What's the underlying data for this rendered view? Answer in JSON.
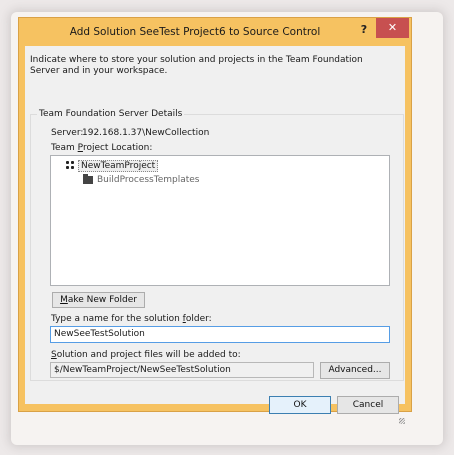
{
  "window": {
    "title": "Add Solution SeeTest Project6 to Source Control",
    "help_label": "?",
    "close_label": "✕"
  },
  "intro_text": "Indicate where to store your solution and projects in the Team Foundation Server and in your workspace.",
  "server_group": {
    "title": "Team Foundation Server Details",
    "server_label": "Server:",
    "server_value": "192.168.1.37\\NewCollection",
    "location_label_pre": "Team ",
    "location_label_key": "P",
    "location_label_post": "roject Location:"
  },
  "tree": {
    "items": [
      {
        "label": "NewTeamProject",
        "icon": "team-project-icon",
        "selected": true
      },
      {
        "label": "BuildProcessTemplates",
        "icon": "folder-icon",
        "selected": false
      }
    ]
  },
  "buttons": {
    "make_new_folder_key": "M",
    "make_new_folder_rest": "ake New Folder",
    "advanced": "Advanced...",
    "ok": "OK",
    "cancel": "Cancel"
  },
  "solution_folder": {
    "label_pre": "Type a name for the solution ",
    "label_key": "f",
    "label_post": "older:",
    "value": "NewSeeTestSolution"
  },
  "added_to": {
    "label_key": "S",
    "label_rest": "olution and project files will be added to:",
    "value": "$/NewTeamProject/NewSeeTestSolution"
  }
}
